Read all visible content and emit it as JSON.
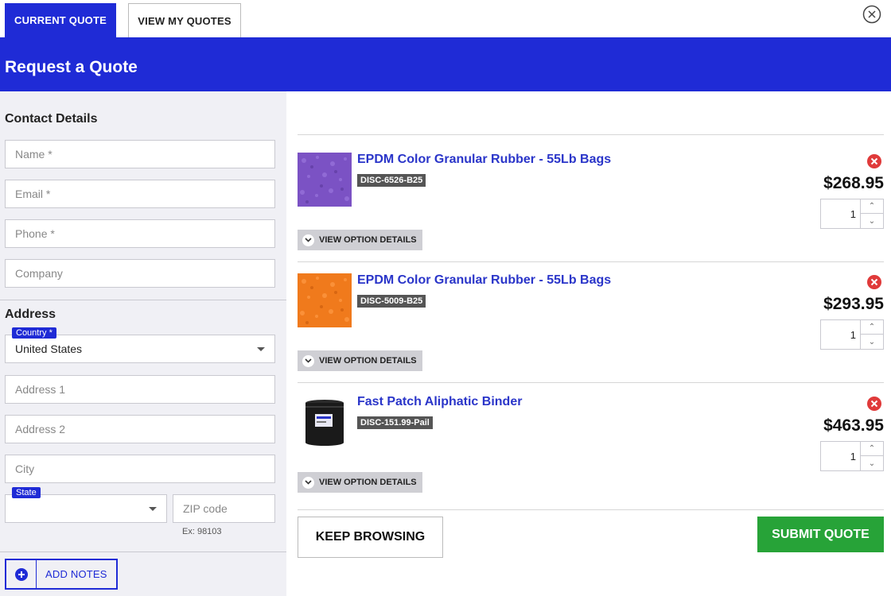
{
  "tabs": {
    "current": "CURRENT QUOTE",
    "my_quotes": "VIEW MY QUOTES"
  },
  "header": {
    "title": "Request a Quote"
  },
  "contact": {
    "title": "Contact Details",
    "name_placeholder": "Name *",
    "email_placeholder": "Email *",
    "phone_placeholder": "Phone *",
    "company_placeholder": "Company"
  },
  "address": {
    "title": "Address",
    "country_label": "Country *",
    "country_value": "United States",
    "address1_placeholder": "Address 1",
    "address2_placeholder": "Address 2",
    "city_placeholder": "City",
    "state_label": "State",
    "state_value": "",
    "zip_placeholder": "ZIP code",
    "zip_hint": "Ex: 98103"
  },
  "notes": {
    "label": "ADD NOTES"
  },
  "items": [
    {
      "title": "EPDM Color Granular Rubber - 55Lb Bags",
      "sku": "DISC-6526-B25",
      "price": "$268.95",
      "qty": "1",
      "details_label": "VIEW OPTION DETAILS",
      "thumb_color": "#7b52c4"
    },
    {
      "title": "EPDM Color Granular Rubber - 55Lb Bags",
      "sku": "DISC-5009-B25",
      "price": "$293.95",
      "qty": "1",
      "details_label": "VIEW OPTION DETAILS",
      "thumb_color": "#f07a1c"
    },
    {
      "title": "Fast Patch Aliphatic Binder",
      "sku": "DISC-151.99-Pail",
      "price": "$463.95",
      "qty": "1",
      "details_label": "VIEW OPTION DETAILS",
      "thumb_color": "#1a1a1a"
    }
  ],
  "actions": {
    "keep_browsing": "KEEP BROWSING",
    "submit": "SUBMIT QUOTE"
  },
  "colors": {
    "brand_blue": "#1f2bd6",
    "submit_green": "#27a338",
    "remove_red": "#e03a3a"
  }
}
